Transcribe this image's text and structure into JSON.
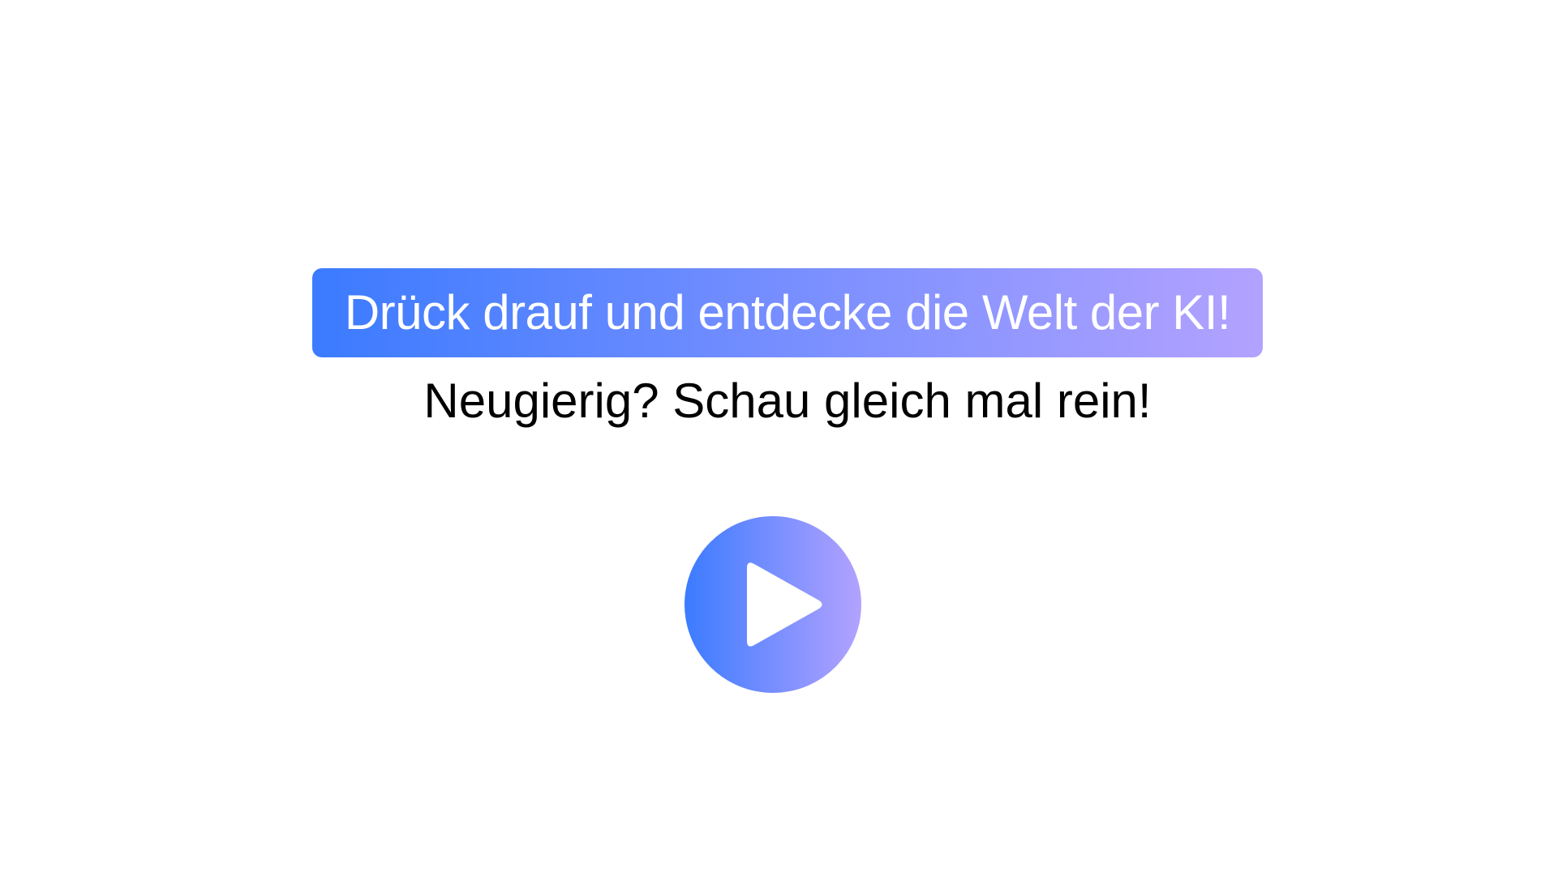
{
  "headline": {
    "text": "Drück drauf und entdecke die Welt der KI!",
    "gradient_start": "#3b7bff",
    "gradient_end": "#b3a2ff",
    "text_color": "#ffffff"
  },
  "subline": {
    "text": "Neugierig? Schau gleich mal rein!",
    "color": "#000000"
  },
  "play_button": {
    "icon": "play-icon",
    "gradient_start": "#3b7bff",
    "gradient_end": "#b3a2ff",
    "icon_color": "#ffffff"
  }
}
